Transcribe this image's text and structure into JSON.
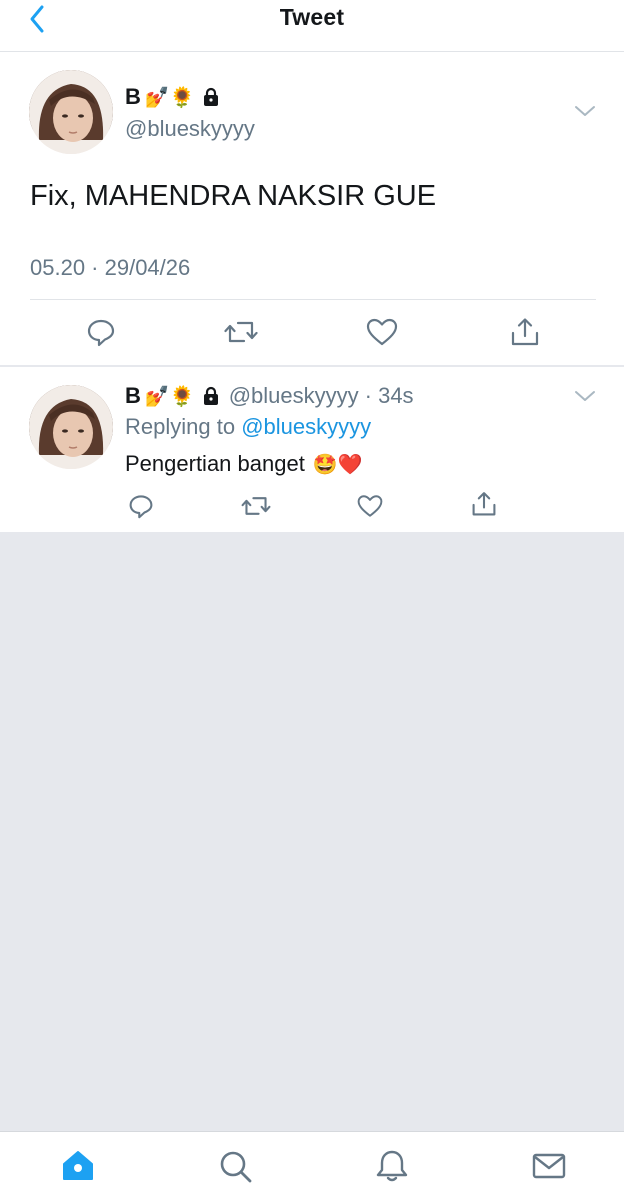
{
  "header": {
    "title": "Tweet",
    "back_icon": "chevron-left-icon"
  },
  "colors": {
    "accent": "#1da1f2",
    "link": "#1b95e0",
    "secondary_text": "#657786",
    "background": "#e6e8ed"
  },
  "main_tweet": {
    "name": "B",
    "name_emojis": "💅🌻",
    "handle": "@blueskyyyy",
    "text": "Fix, MAHENDRA NAKSIR GUE",
    "timestamp": "05.20 · 29/04/26",
    "actions": [
      "reply-icon",
      "retweet-icon",
      "like-icon",
      "share-icon"
    ]
  },
  "reply_tweet": {
    "name": "B",
    "name_emojis": "💅🌻",
    "handle": "@blueskyyyy",
    "time": "· 34s",
    "replying_to_label": "Replying to",
    "replying_to_handle": "@blueskyyyy",
    "text": "Pengertian banget",
    "text_emojis": "🤩❤️",
    "actions": [
      "reply-icon",
      "retweet-icon",
      "like-icon",
      "share-icon"
    ]
  },
  "tabbar": {
    "tabs": [
      "home-icon",
      "search-icon",
      "notifications-icon",
      "messages-icon"
    ],
    "active": "home-icon"
  }
}
